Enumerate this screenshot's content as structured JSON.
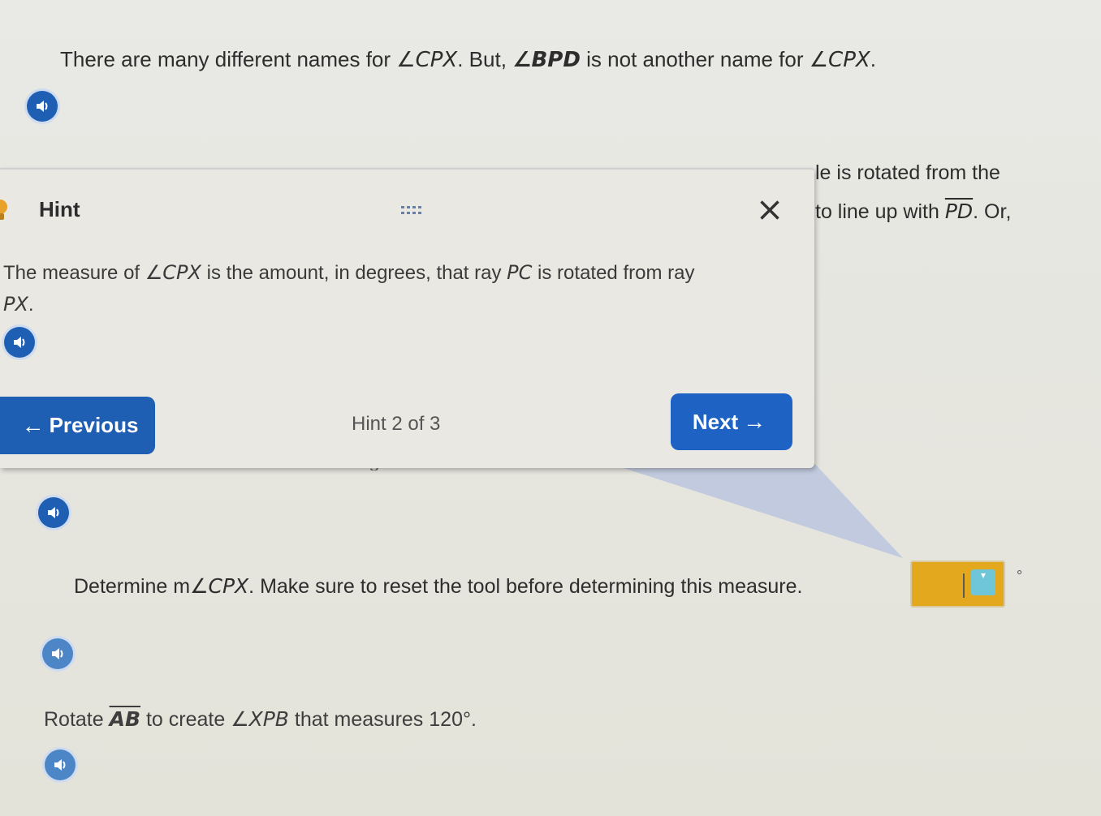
{
  "intro": {
    "prefix": "There are many different names for ",
    "angle1": "∠CPX",
    "mid": ". But, ",
    "angle2": "∠BPD",
    "suffix": " is not another name for ",
    "angle3": "∠CPX",
    "end": "."
  },
  "behind_text": {
    "line1": "le is rotated from the",
    "line2_prefix": "to line up with ",
    "line2_ray": "PD",
    "line2_suffix": ". Or,",
    "partial_line": "m∠APD is read as \"the measure of angle APD.\""
  },
  "hint": {
    "title": "Hint",
    "body_prefix": "The measure of ",
    "body_angle": "∠CPX",
    "body_mid": " is the amount, in degrees, that ray ",
    "body_ray1": "PC",
    "body_mid2": " is rotated from ray",
    "body_ray2": "PX",
    "body_end": ".",
    "counter": "Hint 2 of 3",
    "previous_label": "Previous",
    "next_label": "Next",
    "close_icon": "close-icon"
  },
  "question": {
    "prefix": "Determine m",
    "angle": "∠CPX",
    "suffix": ". Make sure to reset the tool before determining this measure.",
    "answer_value": "",
    "unit": "°"
  },
  "task": {
    "prefix": "Rotate ",
    "line": "AB",
    "mid": " to create ",
    "angle": "∠XPB",
    "mid2": " that measures ",
    "measure": "120°",
    "end": "."
  },
  "colors": {
    "accent": "#1f5fb3",
    "answer_box": "#e4a81e",
    "pointer": "#bcc6de"
  }
}
